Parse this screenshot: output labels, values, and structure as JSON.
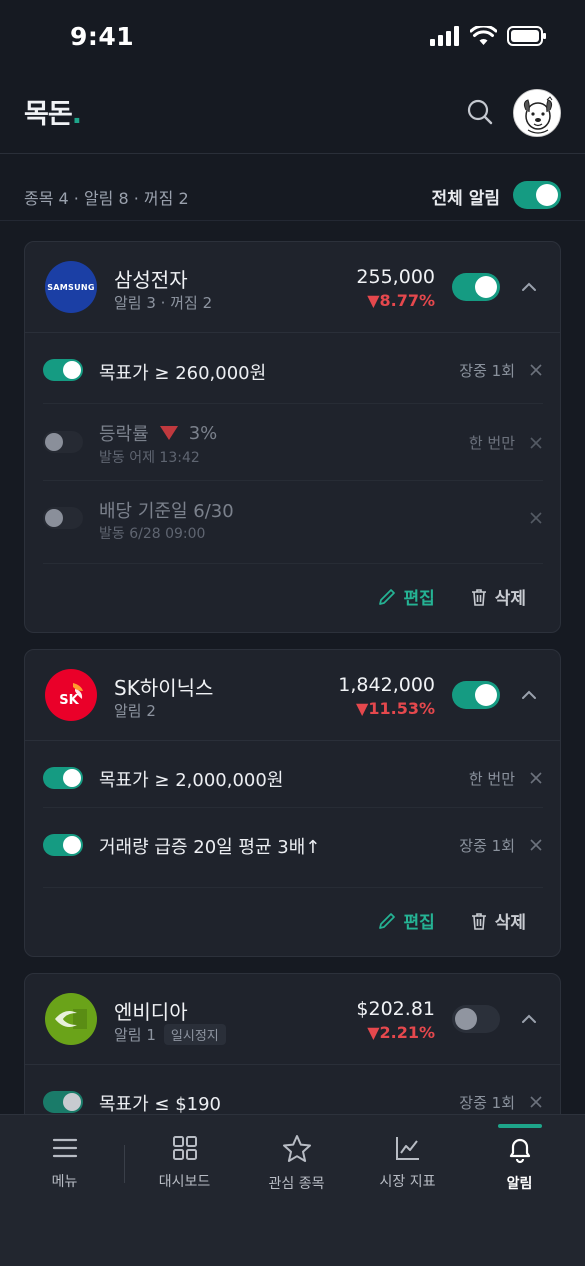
{
  "status_bar": {
    "time": "9:41"
  },
  "header": {
    "logo_text": "목돈",
    "logo_dot": "."
  },
  "summary": {
    "text": "종목 4 · 알림 8 · 꺼짐 2",
    "all_alerts_label": "전체 알림",
    "all_alerts_on": true
  },
  "cards": [
    {
      "name": "삼성전자",
      "sub": "알림 3 · 꺼짐 2",
      "logo_text": "SAMSUNG",
      "price": "255,000",
      "change": "▼8.77%",
      "enabled": true,
      "alerts": [
        {
          "title": "목표가  ≥  260,000원",
          "freq": "장중 1회",
          "on": true
        },
        {
          "title_prefix": "등락률",
          "title_suffix": "3%",
          "meta": "발동 어제 13:42",
          "freq": "한 번만",
          "on": false
        },
        {
          "title": "배당 기준일  6/30",
          "meta": "발동 6/28 09:00",
          "freq": "",
          "on": false
        }
      ],
      "edit_label": "편집",
      "delete_label": "삭제"
    },
    {
      "name": "SK하이닉스",
      "sub": "알림 2",
      "logo_text": "SK",
      "price": "1,842,000",
      "change": "▼11.53%",
      "enabled": true,
      "alerts": [
        {
          "title": "목표가  ≥  2,000,000원",
          "freq": "한 번만",
          "on": true
        },
        {
          "title": "거래량 급증  20일 평균 3배↑",
          "freq": "장중 1회",
          "on": true
        }
      ],
      "edit_label": "편집",
      "delete_label": "삭제"
    },
    {
      "name": "엔비디아",
      "sub": "알림 1",
      "badge": "일시정지",
      "price": "$202.81",
      "change": "▼2.21%",
      "enabled": false,
      "alerts": [
        {
          "title": "목표가  ≤  $190",
          "freq": "장중 1회",
          "on": true
        }
      ]
    }
  ],
  "nav": [
    {
      "label": "메뉴",
      "icon": "menu-icon"
    },
    {
      "label": "대시보드",
      "icon": "dashboard-grid-icon"
    },
    {
      "label": "관심 종목",
      "icon": "star-icon"
    },
    {
      "label": "시장 지표",
      "icon": "chart-line-icon"
    },
    {
      "label": "알림",
      "icon": "bell-icon",
      "active": true
    }
  ],
  "colors": {
    "accent": "#1ea58a",
    "down": "#e5484d",
    "background": "#161a22",
    "card": "#1f232c"
  }
}
